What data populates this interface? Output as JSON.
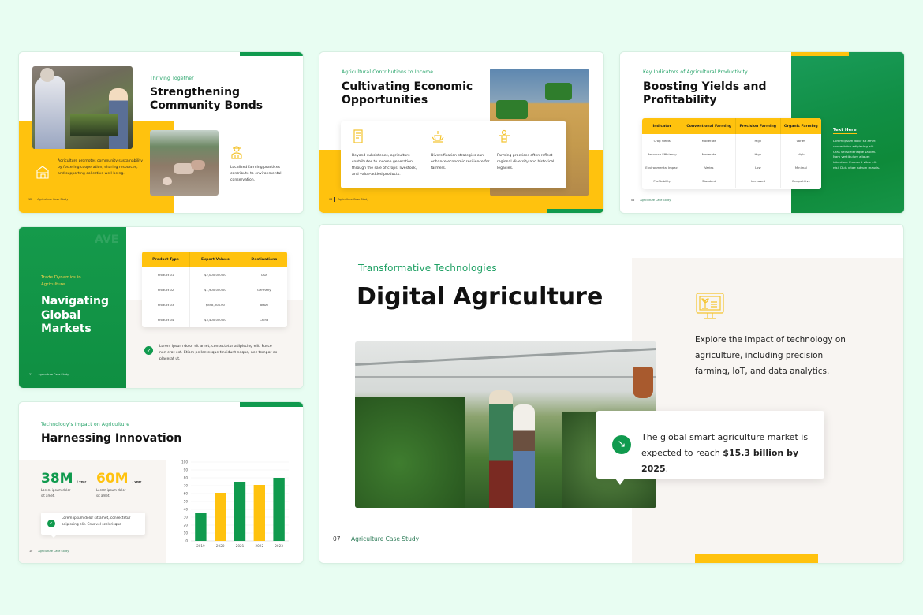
{
  "page": {
    "background": "#E8FDF2",
    "accent_green": "#109A4E",
    "accent_yellow": "#FFC20E",
    "cream": "#F8F5F2"
  },
  "slides": [
    {
      "id": "community",
      "eyebrow": "Thriving Together",
      "title_line1": "Strengthening",
      "title_line2": "Community Bonds",
      "text_left": "Agriculture promotes community sustainability by fostering cooperation, sharing resources, and supporting collective well-being.",
      "text_right": "Localized farming practices contribute to environmental conservation.",
      "footer_num": "12",
      "footer_label": "Agriculture Case Study",
      "icons": [
        "barn-icon",
        "farmer-icon"
      ],
      "images": [
        "farmers-market-photo",
        "livestock-farm-photo"
      ]
    },
    {
      "id": "economic",
      "eyebrow": "Agricultural Contributions to Income",
      "title_line1": "Cultivating Economic",
      "title_line2": "Opportunities",
      "columns": [
        {
          "icon": "document-icon",
          "text": "Beyond subsistence, agriculture contributes to income generation through the sale of crops, livestock, and value-added products."
        },
        {
          "icon": "harvest-icon",
          "text": "Diversification strategies can enhance economic resilience for farmers."
        },
        {
          "icon": "scarecrow-icon",
          "text": "Farming practices often reflect regional diversity and historical legacies."
        }
      ],
      "footer_num": "03",
      "footer_label": "Agriculture Case Study",
      "images": [
        "combine-harvester-photo"
      ]
    },
    {
      "id": "yields",
      "eyebrow": "Key Indicators of Agricultural Productivity",
      "title_line1": "Boosting Yields and",
      "title_line2": "Profitability",
      "table": {
        "headers": [
          "Indicator",
          "Conventional Farming",
          "Precision Farming",
          "Organic Farming"
        ],
        "rows": [
          [
            "Crop Yields",
            "Moderate",
            "High",
            "Varies"
          ],
          [
            "Resource Efficiency",
            "Moderate",
            "High",
            "High"
          ],
          [
            "Environmental Impact",
            "Varies",
            "Low",
            "Minimal"
          ],
          [
            "Profitability",
            "Standard",
            "Increased",
            "Competitive"
          ]
        ]
      },
      "side_title": "Text Here",
      "side_text": "Lorem ipsum dolor sit amet, consectetur adipiscing elit. Cras vel scelerisque sapien. Nam vestibulum aliquet interdum. Praesent vitae elit nisi. Duis vitae rutrum mauris.",
      "footer_num": "06",
      "footer_label": "Agriculture Case Study"
    },
    {
      "id": "markets",
      "eyebrow": "Trade Dynamics in Agriculture",
      "title_line1": "Navigating",
      "title_line2": "Global",
      "title_line3": "Markets",
      "table": {
        "headers": [
          "Product Type",
          "Export Values",
          "Destinations"
        ],
        "rows": [
          [
            "Product 01",
            "$2,000,000.00",
            "USA"
          ],
          [
            "Product 02",
            "$1,900,000.00",
            "Germany"
          ],
          [
            "Product 03",
            "$898,308.00",
            "Brazil"
          ],
          [
            "Product 04",
            "$3,400,000.00",
            "China"
          ]
        ]
      },
      "note": "Lorem ipsum dolor sit amet, consectetur adipiscing elit. Fusce non erat est. Etiam pellentesque tincidunt neque, nec tempor ex placerat ut.",
      "footer_num": "11",
      "footer_label": "Agriculture Case Study"
    },
    {
      "id": "innovation",
      "eyebrow": "Technology's Impact on Agriculture",
      "title": "Harnessing Innovation",
      "stats": [
        {
          "value": "38M",
          "unit": "/ year",
          "label": "Lorem ipsum dolor sit amet.",
          "color": "#109A4E"
        },
        {
          "value": "60M",
          "unit": "/ year",
          "label": "Lorem ipsum dolor sit amet.",
          "color": "#FFC20E"
        }
      ],
      "callout": "Lorem ipsum dolor sit amet, consectetur adipiscing elit. Cras vel scelerisque",
      "footer_num": "10",
      "footer_label": "Agriculture Case Study"
    },
    {
      "id": "digital",
      "eyebrow": "Transformative Technologies",
      "title": "Digital Agriculture",
      "description": "Explore the impact of technology on agriculture, including precision farming, IoT, and data analytics.",
      "stat_text_before": "The global smart agriculture market is expected to reach ",
      "stat_text_bold": "$15.3 billion by 2025",
      "stat_text_after": ".",
      "footer_num": "07",
      "footer_label": "Agriculture Case Study",
      "images": [
        "greenhouse-photo"
      ],
      "icons": [
        "computer-plant-icon",
        "arrow-down-right-icon"
      ]
    }
  ],
  "chart_data": {
    "type": "bar",
    "categories": [
      "2019",
      "2020",
      "2021",
      "2022",
      "2023"
    ],
    "values": [
      36,
      61,
      75,
      71,
      80
    ],
    "colors": [
      "#109A4E",
      "#FFC20E",
      "#109A4E",
      "#FFC20E",
      "#109A4E"
    ],
    "yticks": [
      0,
      10,
      20,
      30,
      40,
      50,
      60,
      70,
      80,
      90,
      100
    ],
    "ylim": [
      0,
      100
    ],
    "title": "",
    "xlabel": "",
    "ylabel": "",
    "grid": true
  }
}
